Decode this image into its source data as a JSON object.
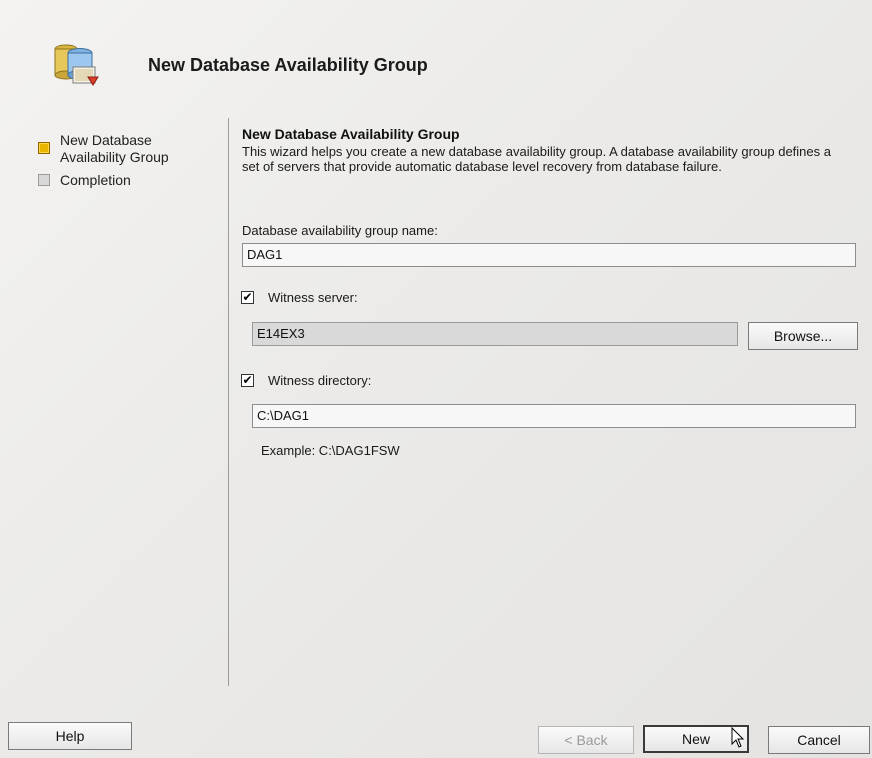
{
  "header": {
    "title": "New Database Availability Group",
    "icon": "database-group-icon"
  },
  "steps": [
    {
      "label": "New Database Availability Group",
      "state": "active"
    },
    {
      "label": "Completion",
      "state": "inactive"
    }
  ],
  "content": {
    "section_title": "New Database Availability Group",
    "description": "This wizard helps you create a new database availability group. A database availability group defines a set of servers that provide automatic database level recovery from database failure.",
    "dag_name_label": "Database availability group name:",
    "dag_name_value": "DAG1",
    "witness_server_label": "Witness server:",
    "witness_server_checked": true,
    "witness_server_value": "E14EX3",
    "browse_label": "Browse...",
    "witness_directory_label": "Witness directory:",
    "witness_directory_checked": true,
    "witness_directory_value": "C:\\DAG1",
    "example_text": "Example: C:\\DAG1FSW"
  },
  "footer": {
    "help_label": "Help",
    "back_label": "< Back",
    "new_label": "New",
    "cancel_label": "Cancel"
  }
}
